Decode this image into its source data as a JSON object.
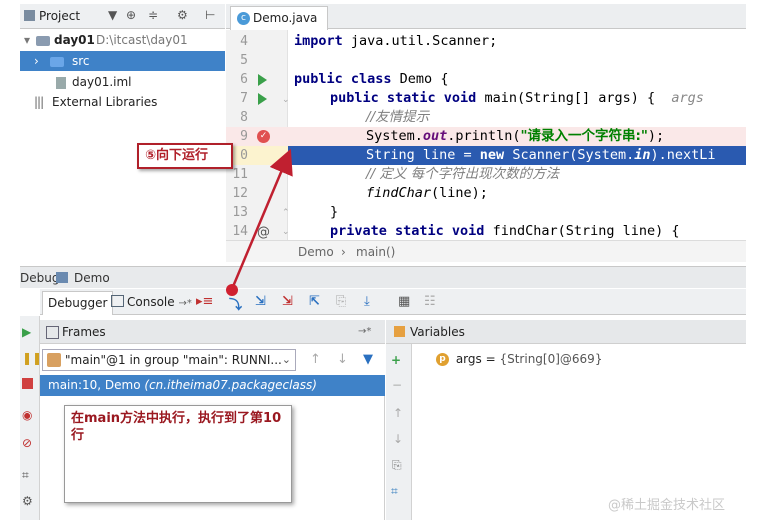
{
  "project_panel": {
    "title": "Project",
    "tree": [
      {
        "label": "day01",
        "path": "D:\\itcast\\day01"
      },
      {
        "label": "src"
      },
      {
        "label": "day01.iml"
      },
      {
        "label": "External Libraries"
      }
    ]
  },
  "editor": {
    "tab": "Demo.java",
    "lines": [
      {
        "n": "4"
      },
      {
        "n": "5"
      },
      {
        "n": "6"
      },
      {
        "n": "7"
      },
      {
        "n": "8"
      },
      {
        "n": "9"
      },
      {
        "n": "0"
      },
      {
        "n": "11"
      },
      {
        "n": "12"
      },
      {
        "n": "13"
      },
      {
        "n": "14"
      }
    ],
    "code": {
      "l4a": "import",
      "l4b": " java.util.Scanner;",
      "l6a": "public class",
      "l6b": " Demo {",
      "l7a": "public static void",
      "l7b": " main(String[] args) {  ",
      "l7hint": "args",
      "l8": "//友情提示",
      "l9a": "System.",
      "l9b": "out",
      "l9c": ".println(",
      "l9d": "\"请录入一个字符串:\"",
      "l9e": ");",
      "l10a": "String line = ",
      "l10b": "new",
      "l10c": " Scanner(System.",
      "l10d": "in",
      "l10e": ").nextLi",
      "l11": "// 定义 每个字符出现次数的方法",
      "l12a": "findChar",
      "l12b": "(line);",
      "l13": "}",
      "l14a": "private static void",
      "l14b": " findChar(String line) {"
    },
    "breadcrumb": {
      "a": "Demo",
      "sep": "›",
      "b": "main()"
    }
  },
  "debug": {
    "title": "Debug",
    "config": "Demo",
    "tabs": {
      "debugger": "Debugger",
      "console": "Console",
      "console_arrow": "→*"
    },
    "frames_title": "Frames",
    "frames_pin": "→*",
    "thread": "\"main\"@1 in group \"main\": RUNNI...",
    "frame": {
      "method": "main:10, Demo",
      "class": "(cn.itheima07.packageclass)"
    },
    "variables_title": "Variables",
    "variable": {
      "name": "args",
      "eq": " = ",
      "value": "{String[0]@669}"
    }
  },
  "annotations": {
    "step": "⑤向下运行",
    "note": "在main方法中执行，执行到了第10行"
  },
  "watermark": "@稀土掘金技术社区",
  "colors": {
    "selection": "#3f82c8",
    "exec_line": "#2a5ab0",
    "annotation_red": "#b0202a"
  }
}
